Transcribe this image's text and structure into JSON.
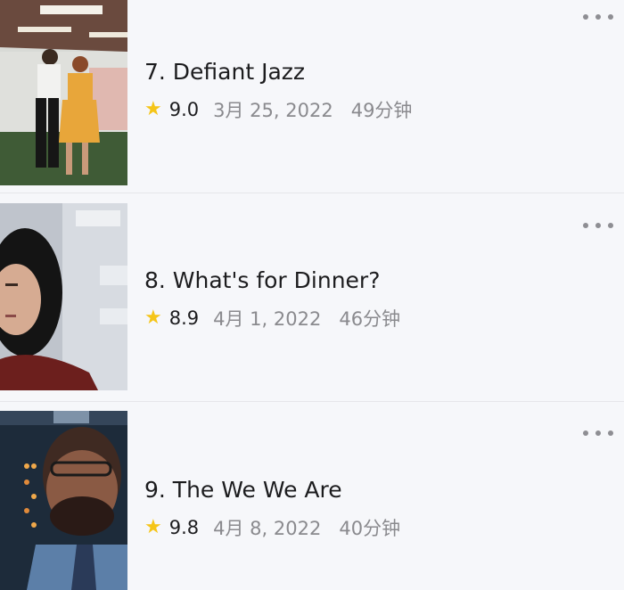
{
  "episodes": [
    {
      "title": "7. Defiant Jazz",
      "rating": "9.0",
      "date": "3月 25, 2022",
      "duration": "49分钟",
      "thumbnail": "dance-scene-thumbnail"
    },
    {
      "title": "8. What's for Dinner?",
      "rating": "8.9",
      "date": "4月 1, 2022",
      "duration": "46分钟",
      "thumbnail": "woman-portrait-thumbnail"
    },
    {
      "title": "9. The We We Are",
      "rating": "9.8",
      "date": "4月 8, 2022",
      "duration": "40分钟",
      "thumbnail": "man-portrait-thumbnail"
    }
  ],
  "icons": {
    "more": "more-horizontal-icon",
    "star": "star-icon"
  },
  "colors": {
    "background": "#f6f7fa",
    "star": "#f5c518",
    "secondary_text": "#8a8a8e",
    "primary_text": "#1c1c1e"
  }
}
